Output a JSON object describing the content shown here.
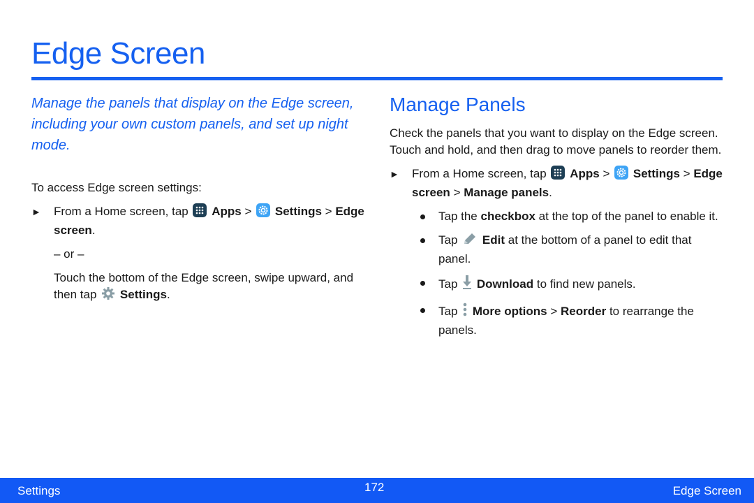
{
  "page": {
    "title": "Edge Screen",
    "accent_color": "#1560f0"
  },
  "left": {
    "intro": "Manage the panels that display on the Edge screen, including your own custom panels, and set up night mode.",
    "access_label": "To access Edge screen settings:",
    "step1": {
      "prefix": "From a Home screen, tap",
      "apps": "Apps",
      "sep1": ">",
      "settings": "Settings",
      "sep2": ">",
      "edge_screen": "Edge screen",
      "end": "."
    },
    "or_text": "– or –",
    "step2": {
      "prefix": "Touch the bottom of the Edge screen, swipe upward, and then tap",
      "settings": "Settings",
      "end": "."
    }
  },
  "right": {
    "section_title": "Manage Panels",
    "description": "Check the panels that you want to display on the Edge screen. Touch and hold, and then drag to move panels to reorder them.",
    "step": {
      "prefix": "From a Home screen, tap",
      "apps": "Apps",
      "sep1": ">",
      "settings": "Settings",
      "sep2": ">",
      "edge_screen": "Edge screen",
      "sep3": ">",
      "manage_panels": "Manage panels",
      "end": "."
    },
    "bullets": [
      {
        "pre": "Tap the",
        "bold": "checkbox",
        "post": "at the top of the panel to enable it."
      },
      {
        "pre": "Tap",
        "bold": "Edit",
        "post": "at the bottom of a panel to edit that panel."
      },
      {
        "pre": "Tap",
        "bold": "Download",
        "post": "to find new panels."
      },
      {
        "pre": "Tap",
        "bold": "More options",
        "sep": ">",
        "bold2": "Reorder",
        "post": "to rearrange the panels."
      }
    ]
  },
  "footer": {
    "left": "Settings",
    "page_number": "172",
    "right": "Edge Screen"
  },
  "icons": {
    "arrow": "►"
  }
}
